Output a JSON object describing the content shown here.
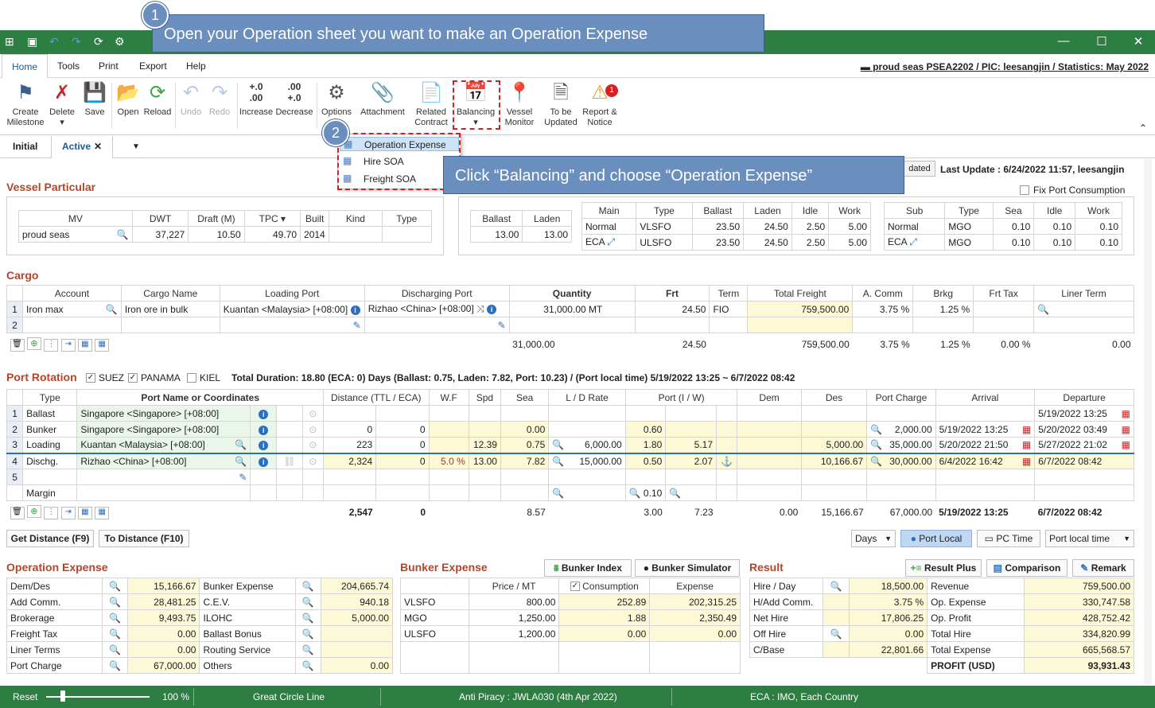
{
  "callout1": {
    "num": "1",
    "text": "Open your Operation sheet you want to make an Operation Expense"
  },
  "callout2": {
    "num": "2",
    "text": "Click “Balancing” and choose “Operation Expense”"
  },
  "menu": [
    "Home",
    "Tools",
    "Print",
    "Export",
    "Help"
  ],
  "vessel_info": "proud seas PSEA2202 / PIC: leesangjin / Statistics: May 2022",
  "ribbon": {
    "create": "Create Milestone",
    "delete": "Delete",
    "save": "Save",
    "open": "Open",
    "reload": "Reload",
    "undo": "Undo",
    "redo": "Redo",
    "increase": "Increase",
    "decrease": "Decrease",
    "options": "Options",
    "attachment": "Attachment",
    "related": "Related Contract",
    "balancing": "Balancing",
    "vessel_monitor": "Vessel Monitor",
    "to_be_updated": "To be Updated",
    "report": "Report & Notice",
    "inc_top": "+.0",
    "inc_bot": ".00",
    "dec_top": ".00",
    "dec_bot": "+.0",
    "report_badge": "1"
  },
  "dropdown": [
    "Operation Expense",
    "Hire SOA",
    "Freight SOA"
  ],
  "tabs": {
    "initial": "Initial",
    "active": "Active"
  },
  "header_right": {
    "updated": "dated",
    "last": "Last Update : 6/24/2022 11:57, leesangjin",
    "fix_port": "Fix Port Consumption"
  },
  "vessel": {
    "title": "Vessel Particular",
    "cols": [
      "MV",
      "DWT",
      "Draft (M)",
      "TPC",
      "Built",
      "Kind",
      "Type"
    ],
    "row": [
      "proud seas",
      "37,227",
      "10.50",
      "49.70",
      "2014",
      "",
      ""
    ],
    "ballast_cols": [
      "Ballast",
      "Laden"
    ],
    "ballast_row": [
      "13.00",
      "13.00"
    ],
    "main_cols": [
      "Main",
      "Type",
      "Ballast",
      "Laden",
      "Idle",
      "Work"
    ],
    "main_rows": [
      [
        "Normal",
        "VLSFO",
        "23.50",
        "24.50",
        "2.50",
        "5.00"
      ],
      [
        "ECA",
        "ULSFO",
        "23.50",
        "24.50",
        "2.50",
        "5.00"
      ]
    ],
    "sub_cols": [
      "Sub",
      "Type",
      "Sea",
      "Idle",
      "Work"
    ],
    "sub_rows": [
      [
        "Normal",
        "MGO",
        "0.10",
        "0.10",
        "0.10"
      ],
      [
        "ECA",
        "MGO",
        "0.10",
        "0.10",
        "0.10"
      ]
    ]
  },
  "cargo": {
    "title": "Cargo",
    "cols": [
      "Account",
      "Cargo Name",
      "Loading Port",
      "Discharging Port",
      "Quantity",
      "Frt",
      "Term",
      "Total Freight",
      "A. Comm",
      "Brkg",
      "Frt Tax",
      "Liner Term"
    ],
    "row1": [
      "1",
      "Iron max",
      "Iron ore in bulk",
      "Kuantan <Malaysia> [+08:00]",
      "Rizhao <China> [+08:00]",
      "31,000.00",
      "MT",
      "24.50",
      "FIO",
      "759,500.00",
      "3.75 %",
      "1.25 %",
      "",
      ""
    ],
    "row2": [
      "2"
    ],
    "total": [
      "31,000.00",
      "24.50",
      "759,500.00",
      "3.75 %",
      "1.25 %",
      "0.00 %",
      "0.00"
    ]
  },
  "port": {
    "title": "Port Rotation",
    "suez": "SUEZ",
    "panama": "PANAMA",
    "kiel": "KIEL",
    "summary": "Total Duration: 18.80 (ECA: 0) Days (Ballast: 0.75, Laden: 7.82, Port: 10.23) / (Port local time) 5/19/2022 13:25 ~ 6/7/2022 08:42",
    "cols": [
      "Type",
      "Port Name or Coordinates",
      "Distance (TTL / ECA)",
      "W.F",
      "Spd",
      "Sea",
      "L / D Rate",
      "Port (I / W)",
      "Dem",
      "Des",
      "Port Charge",
      "Arrival",
      "Departure"
    ],
    "rows": [
      [
        "1",
        "Ballast",
        "Singapore <Singapore> [+08:00]",
        "",
        "",
        "",
        "",
        "",
        "",
        "",
        "",
        "",
        "",
        "",
        "",
        "5/19/2022 13:25"
      ],
      [
        "2",
        "Bunker",
        "Singapore <Singapore> [+08:00]",
        "0",
        "0",
        "",
        "",
        "0.00",
        "",
        "0.60",
        "",
        "",
        "",
        "2,000.00",
        "5/19/2022 13:25",
        "5/20/2022 03:49"
      ],
      [
        "3",
        "Loading",
        "Kuantan <Malaysia> [+08:00]",
        "223",
        "0",
        "",
        "12.39",
        "0.75",
        "6,000.00",
        "1.80",
        "5.17",
        "",
        "5,000.00",
        "35,000.00",
        "5/20/2022 21:50",
        "5/27/2022 21:02"
      ],
      [
        "4",
        "Dischg.",
        "Rizhao <China> [+08:00]",
        "2,324",
        "0",
        "5.0 %",
        "13.00",
        "7.82",
        "15,000.00",
        "0.50",
        "2.07",
        "",
        "10,166.67",
        "30,000.00",
        "6/4/2022 16:42",
        "6/7/2022 08:42"
      ],
      [
        "5",
        "",
        "",
        "",
        "",
        "",
        "",
        "",
        "",
        "",
        "",
        "",
        "",
        "",
        "",
        ""
      ]
    ],
    "margin": "Margin",
    "margin_port": "0.10",
    "total": [
      "2,547",
      "0",
      "8.57",
      "3.00",
      "7.23",
      "0.00",
      "15,166.67",
      "67,000.00",
      "5/19/2022 13:25",
      "6/7/2022 08:42"
    ]
  },
  "buttons": {
    "get_distance": "Get Distance (F9)",
    "to_distance": "To Distance (F10)",
    "days": "Days",
    "port_local": "Port Local",
    "pc_time": "PC Time",
    "port_local_time": "Port local time"
  },
  "opex": {
    "title": "Operation Expense",
    "left": [
      [
        "Dem/Des",
        "15,166.67"
      ],
      [
        "Add Comm.",
        "28,481.25"
      ],
      [
        "Brokerage",
        "9,493.75"
      ],
      [
        "Freight Tax",
        "0.00"
      ],
      [
        "Liner Terms",
        "0.00"
      ],
      [
        "Port Charge",
        "67,000.00"
      ]
    ],
    "right": [
      [
        "Bunker Expense",
        "204,665.74"
      ],
      [
        "C.E.V.",
        "940.18"
      ],
      [
        "ILOHC",
        "5,000.00"
      ],
      [
        "Ballast Bonus",
        ""
      ],
      [
        "Routing Service",
        ""
      ],
      [
        "Others",
        "0.00"
      ]
    ]
  },
  "bunker": {
    "title": "Bunker Expense",
    "index": "Bunker Index",
    "simulator": "Bunker Simulator",
    "cols": [
      "",
      "Price / MT",
      "Consumption",
      "Expense"
    ],
    "rows": [
      [
        "VLSFO",
        "800.00",
        "252.89",
        "202,315.25"
      ],
      [
        "MGO",
        "1,250.00",
        "1.88",
        "2,350.49"
      ],
      [
        "ULSFO",
        "1,200.00",
        "0.00",
        "0.00"
      ]
    ]
  },
  "result": {
    "title": "Result",
    "plus": "Result Plus",
    "comparison": "Comparison",
    "remark": "Remark",
    "left": [
      [
        "Hire / Day",
        "18,500.00"
      ],
      [
        "H/Add Comm.",
        "3.75 %"
      ],
      [
        "Net Hire",
        "17,806.25"
      ],
      [
        "Off Hire",
        "0.00"
      ],
      [
        "C/Base",
        "22,801.66"
      ]
    ],
    "right": [
      [
        "Revenue",
        "759,500.00"
      ],
      [
        "Op. Expense",
        "330,747.58"
      ],
      [
        "Op. Profit",
        "428,752.42"
      ],
      [
        "Total Hire",
        "334,820.99"
      ],
      [
        "Total Expense",
        "665,568.57"
      ],
      [
        "PROFIT (USD)",
        "93,931.43"
      ]
    ]
  },
  "status": {
    "reset": "Reset",
    "zoom": "100 %",
    "gcl": "Great Circle Line",
    "anti": "Anti Piracy : JWLA030 (4th Apr 2022)",
    "eca": "ECA : IMO, Each Country"
  },
  "colors": {
    "title": "#2e7d43",
    "accent": "#b5452a",
    "callout": "#6a8fbe",
    "highlight_red": "#d62020"
  }
}
